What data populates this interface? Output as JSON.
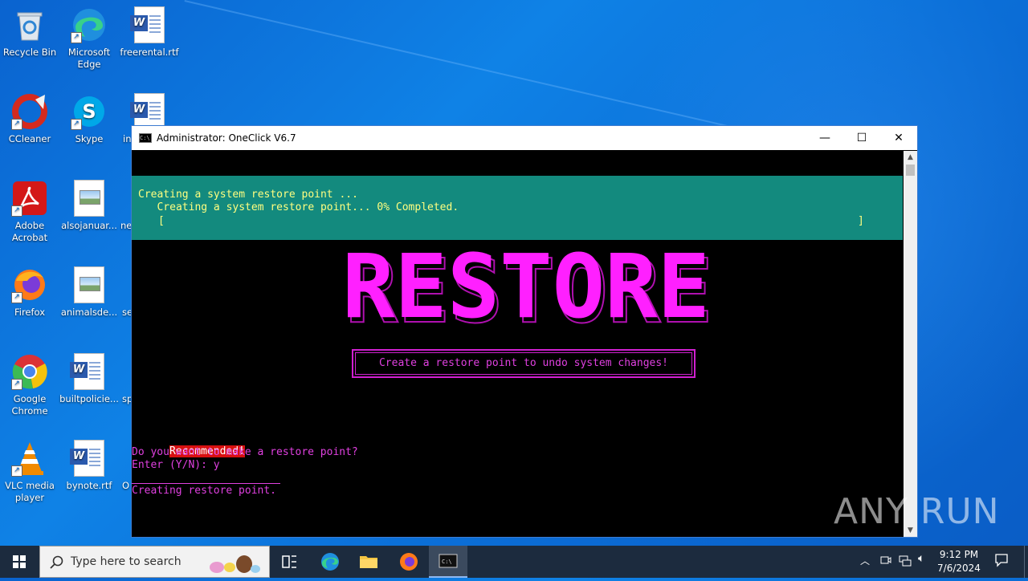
{
  "desktop": {
    "icons": [
      {
        "label": "Recycle Bin",
        "icon": "recycle-bin-icon"
      },
      {
        "label": "Microsoft Edge",
        "icon": "edge-icon"
      },
      {
        "label": "freerental.rtf",
        "icon": "word-doc-icon"
      },
      {
        "label": "CCleaner",
        "icon": "ccleaner-icon"
      },
      {
        "label": "Skype",
        "icon": "skype-icon"
      },
      {
        "label": "in",
        "icon": "word-doc-icon"
      },
      {
        "label": "Adobe Acrobat",
        "icon": "acrobat-icon"
      },
      {
        "label": "alsojanuar...",
        "icon": "image-file-icon"
      },
      {
        "label": "ne",
        "icon": "file-icon"
      },
      {
        "label": "Firefox",
        "icon": "firefox-icon"
      },
      {
        "label": "animalsde...",
        "icon": "image-file-icon"
      },
      {
        "label": "se",
        "icon": "file-icon"
      },
      {
        "label": "Google Chrome",
        "icon": "chrome-icon"
      },
      {
        "label": "builtpolicie...",
        "icon": "word-doc-icon"
      },
      {
        "label": "sp",
        "icon": "file-icon"
      },
      {
        "label": "VLC media player",
        "icon": "vlc-icon"
      },
      {
        "label": "bynote.rtf",
        "icon": "word-doc-icon"
      },
      {
        "label": "O",
        "icon": "file-icon"
      }
    ]
  },
  "window": {
    "title": "Administrator:  OneClick V6.7",
    "minimize": "—",
    "maximize": "☐",
    "close": "✕"
  },
  "console": {
    "progress_line1": "Creating a system restore point ...",
    "progress_line2": "   Creating a system restore point... 0% Completed.",
    "progress_bar_open": "[",
    "progress_bar_close": "]",
    "progress_percent": 0,
    "ascii_title": "RESTORE",
    "subtitle": "Create a restore point to undo system changes!",
    "recommended": "Recommended!",
    "question": "Do you want to make a restore point?",
    "prompt": "Enter (Y/N): y",
    "status": "Creating restore point.",
    "colors": {
      "banner_bg": "#138a7e",
      "banner_text": "#ffff80",
      "magenta": "#e040e0",
      "recommended_bg": "#d81010"
    }
  },
  "watermark": "ANY RUN",
  "taskbar": {
    "search_placeholder": "Type here to search",
    "clock_time": "9:12 PM",
    "clock_date": "7/6/2024"
  }
}
